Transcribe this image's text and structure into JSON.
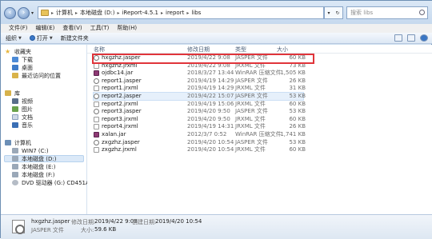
{
  "address": {
    "segments": [
      "计算机",
      "本地磁盘 (D:)",
      "iReport-4.5.1",
      "ireport",
      "libs"
    ]
  },
  "search": {
    "placeholder": "搜索 libs"
  },
  "menu": [
    "文件(F)",
    "编辑(E)",
    "查看(V)",
    "工具(T)",
    "帮助(H)"
  ],
  "toolbar": {
    "organize": "组织",
    "open": "打开",
    "new_folder": "新建文件夹"
  },
  "sidebar": [
    {
      "label": "收藏夹",
      "icon": "star-icon"
    },
    {
      "label": "下载",
      "icon": "download-folder-icon"
    },
    {
      "label": "桌面",
      "icon": "desktop-icon"
    },
    {
      "label": "最近访问的位置",
      "icon": "recent-places-icon"
    },
    {
      "label": "库",
      "icon": "library-icon"
    },
    {
      "label": "视频",
      "icon": "video-icon"
    },
    {
      "label": "图片",
      "icon": "picture-icon"
    },
    {
      "label": "文档",
      "icon": "document-icon"
    },
    {
      "label": "音乐",
      "icon": "music-icon"
    },
    {
      "label": "计算机",
      "icon": "computer-icon"
    },
    {
      "label": "WIN7 (C:)",
      "icon": "drive-icon"
    },
    {
      "label": "本地磁盘 (D:)",
      "icon": "drive-icon"
    },
    {
      "label": "本地磁盘 (E:)",
      "icon": "drive-icon"
    },
    {
      "label": "本地磁盘 (F:)",
      "icon": "drive-icon"
    },
    {
      "label": "DVD 驱动器 (G:) CD451A1",
      "icon": "dvd-icon"
    }
  ],
  "columns": {
    "name": "名称",
    "date": "修改日期",
    "type": "类型",
    "size": "大小"
  },
  "files": [
    {
      "name": "hxgzhz.jasper",
      "date": "2019/4/22 9:08",
      "type": "JASPER 文件",
      "size": "60 KB",
      "kind": "jasper"
    },
    {
      "name": "hxgzhz.jrxml",
      "date": "2019/4/22 9:08",
      "type": "JRXML 文件",
      "size": "73 KB",
      "kind": "jrxml"
    },
    {
      "name": "ojdbc14.jar",
      "date": "2018/3/27 13:44",
      "type": "WinRAR 压缩文件",
      "size": "1,505 KB",
      "kind": "jar"
    },
    {
      "name": "report1.jasper",
      "date": "2019/4/19 14:29",
      "type": "JASPER 文件",
      "size": "26 KB",
      "kind": "jasper"
    },
    {
      "name": "report1.jrxml",
      "date": "2019/4/19 14:29",
      "type": "JRXML 文件",
      "size": "31 KB",
      "kind": "jrxml"
    },
    {
      "name": "report2.jasper",
      "date": "2019/4/22 15:07",
      "type": "JASPER 文件",
      "size": "53 KB",
      "kind": "jasper"
    },
    {
      "name": "report2.jrxml",
      "date": "2019/4/19 15:06",
      "type": "JRXML 文件",
      "size": "60 KB",
      "kind": "jrxml"
    },
    {
      "name": "report3.jasper",
      "date": "2019/4/20 9:50",
      "type": "JASPER 文件",
      "size": "53 KB",
      "kind": "jasper"
    },
    {
      "name": "report3.jrxml",
      "date": "2019/4/20 9:50",
      "type": "JRXML 文件",
      "size": "60 KB",
      "kind": "jrxml"
    },
    {
      "name": "report4.jrxml",
      "date": "2019/4/19 14:31",
      "type": "JRXML 文件",
      "size": "26 KB",
      "kind": "jrxml"
    },
    {
      "name": "xalan.jar",
      "date": "2012/3/7 0:52",
      "type": "WinRAR 压缩文件",
      "size": "1,741 KB",
      "kind": "jar"
    },
    {
      "name": "zxgzhz.jasper",
      "date": "2019/4/20 10:54",
      "type": "JASPER 文件",
      "size": "53 KB",
      "kind": "jasper"
    },
    {
      "name": "zxgzhz.jrxml",
      "date": "2019/4/20 10:54",
      "type": "JRXML 文件",
      "size": "60 KB",
      "kind": "jrxml"
    }
  ],
  "details": {
    "filename": "hxgzhz.jasper",
    "modified_label": "修改日期:",
    "modified": "2019/4/22 9:08",
    "created_label": "创建日期:",
    "created": "2019/4/20 10:54",
    "type": "JASPER 文件",
    "size_label": "大小:",
    "size": "59.6 KB"
  },
  "colors": {
    "highlight_box": "#e0343a",
    "selection": "#dbe9f8"
  }
}
